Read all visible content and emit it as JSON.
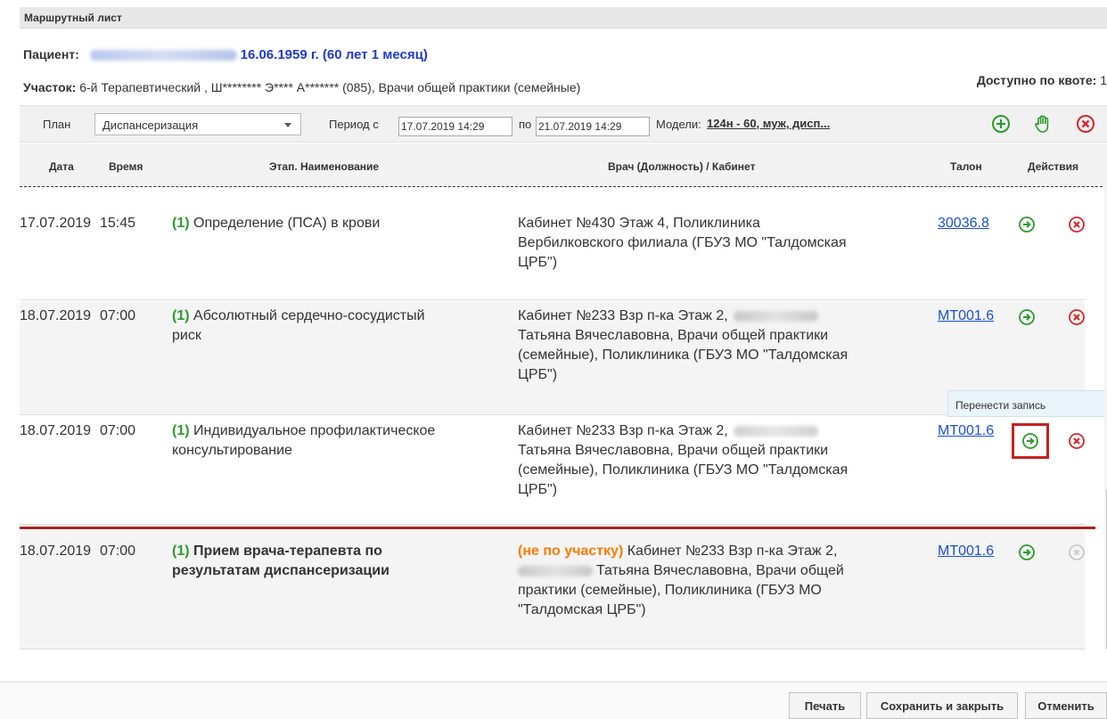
{
  "window": {
    "title": "Маршрутный лист"
  },
  "patient": {
    "label": "Пациент:",
    "dob": "16.06.1959 г. (60 лет 1 месяц)",
    "uchastok_label": "Участок:",
    "uchastok_value": "6-й Терапевтический , Ш******** Э**** А******* (085), Врачи общей практики (семейные)",
    "quota_label": "Доступно по квоте:",
    "quota_value": "1"
  },
  "toolbar": {
    "plan_label": "План",
    "plan_value": "Диспансеризация",
    "period_label": "Период с",
    "date_from": "17.07.2019 14:29",
    "to_label": "по",
    "date_to": "21.07.2019 14:29",
    "models_label": "Модели:",
    "models_link": "124н - 60, муж, дисп..."
  },
  "columns": {
    "date": "Дата",
    "time": "Время",
    "stage": "Этап. Наименование",
    "doctor": "Врач (Должность) / Кабинет",
    "talon": "Талон",
    "actions": "Действия"
  },
  "rows": [
    {
      "date": "17.07.2019",
      "time": "15:45",
      "stage_num": "(1)",
      "name_lines": [
        "Определение (ПСА) в крови"
      ],
      "doctor_lines": [
        "Кабинет №430 Этаж 4, Поликлиника",
        "Вербилковского филиала (ГБУЗ МО \"Талдомская",
        "ЦРБ\")"
      ],
      "talon": "30036.8"
    },
    {
      "date": "18.07.2019",
      "time": "07:00",
      "stage_num": "(1)",
      "name_lines": [
        "Абсолютный сердечно-сосудистый",
        "риск"
      ],
      "doctor_lines": [
        "Кабинет №233 Взр п-ка Этаж 2,",
        "Татьяна Вячеславовна, Врачи общей практики",
        "(семейные), Поликлиника (ГБУЗ МО \"Талдомская",
        "ЦРБ\")"
      ],
      "talon": "МТ001.6"
    },
    {
      "date": "18.07.2019",
      "time": "07:00",
      "stage_num": "(1)",
      "name_lines": [
        "Индивидуальное профилактическое",
        "консультирование"
      ],
      "doctor_lines": [
        "Кабинет №233 Взр п-ка Этаж 2,",
        "Татьяна Вячеславовна, Врачи общей практики",
        "(семейные), Поликлиника (ГБУЗ МО \"Талдомская",
        "ЦРБ\")"
      ],
      "talon": "МТ001.6"
    },
    {
      "date": "18.07.2019",
      "time": "07:00",
      "stage_num": "(1)",
      "name_lines": [
        "Прием врача-терапевта по",
        "результатам диспансеризации"
      ],
      "warning": "(не по участку)",
      "doctor_lines": [
        "Кабинет №233 Взр п-ка Этаж 2,",
        "Татьяна Вячеславовна, Врачи общей",
        "практики (семейные), Поликлиника (ГБУЗ МО",
        "\"Талдомская ЦРБ\")"
      ],
      "talon": "МТ001.6"
    }
  ],
  "tooltip": "Перенести запись",
  "footer": {
    "print": "Печать",
    "save_close": "Сохранить и закрыть",
    "cancel": "Отменить"
  },
  "icons": {
    "add": "plus-circle-icon",
    "hand": "hand-icon",
    "remove": "x-circle-icon",
    "move": "arrow-right-circle-icon"
  },
  "colors": {
    "green": "#2b9c2b",
    "red": "#d9262b",
    "link": "#1a4fd6",
    "warning": "#ff7a00",
    "highlight": "#c8211e"
  }
}
